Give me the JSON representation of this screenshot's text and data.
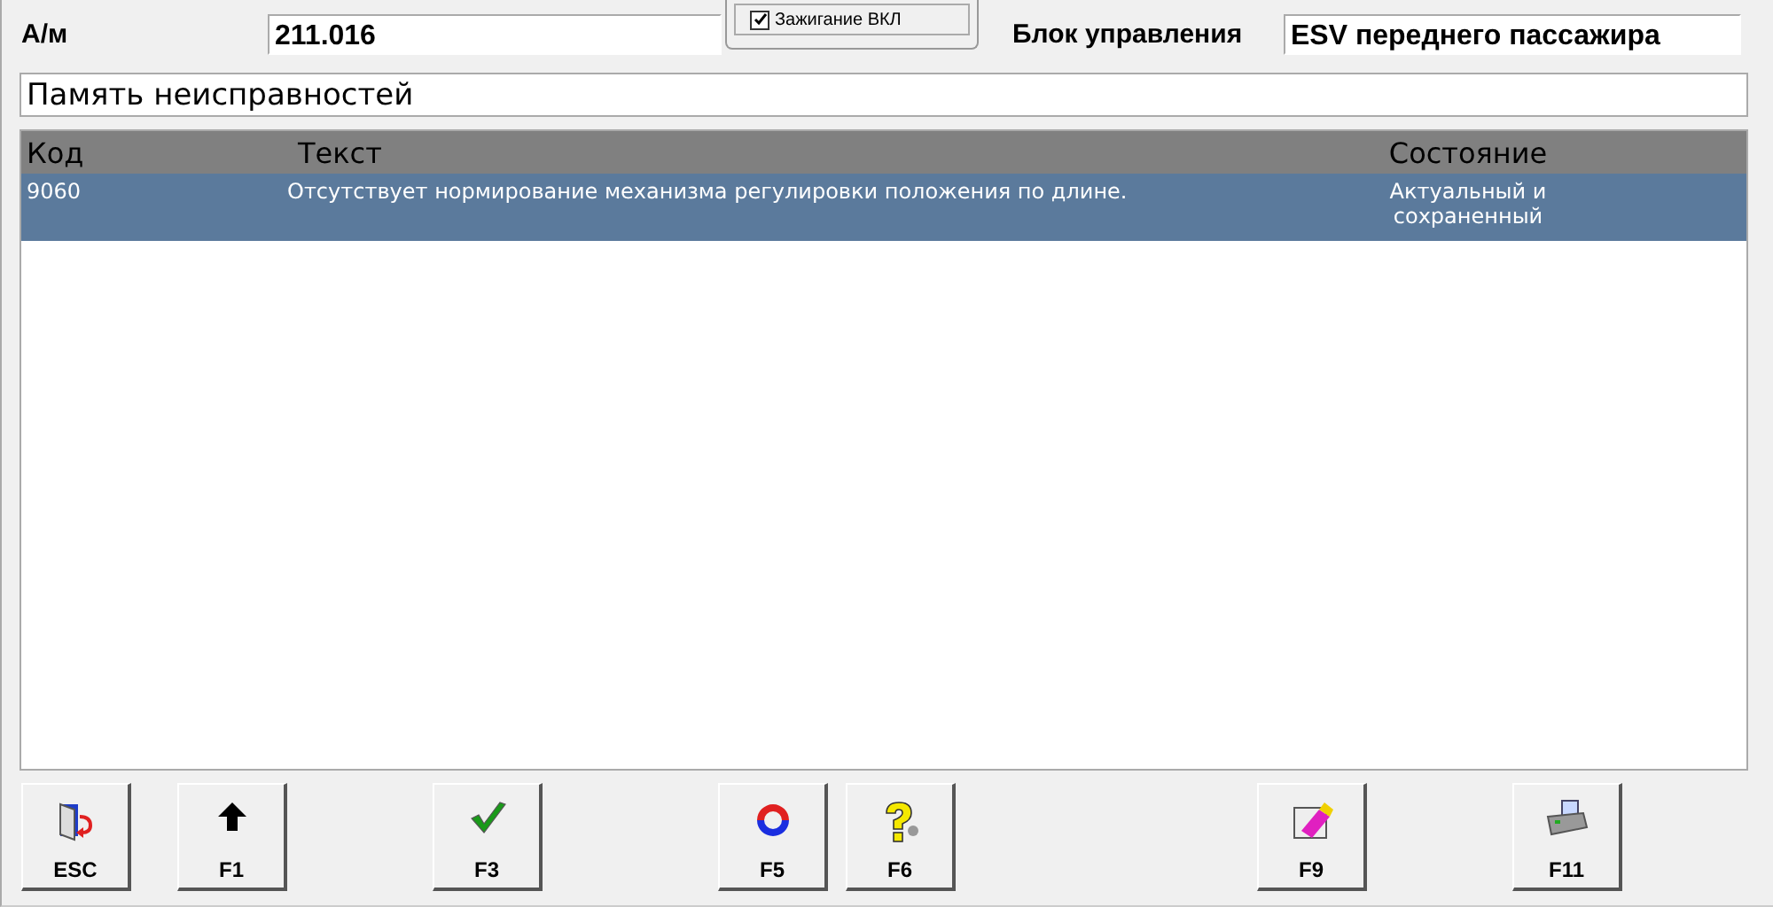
{
  "vehicle": {
    "label": "А/м",
    "value": "211.016"
  },
  "ignition": {
    "label": "Зажигание ВКЛ",
    "checked": true
  },
  "control_unit": {
    "label": "Блок управления",
    "value": "ESV переднего пассажира"
  },
  "section_title": "Память неисправностей",
  "table": {
    "columns": [
      "Код",
      "Текст",
      "Состояние"
    ],
    "rows": [
      {
        "code": "9060",
        "text": "Отсутствует нормирование механизма регулировки положения по длине.",
        "state": "Актуальный и сохраненный",
        "selected": true
      }
    ]
  },
  "buttons": [
    {
      "kind": "exit",
      "label": "ESC"
    },
    {
      "kind": "up",
      "label": "F1"
    },
    {
      "kind": "check",
      "label": "F3"
    },
    {
      "kind": "refresh",
      "label": "F5"
    },
    {
      "kind": "help",
      "label": "F6"
    },
    {
      "kind": "erase",
      "label": "F9"
    },
    {
      "kind": "print",
      "label": "F11"
    }
  ]
}
